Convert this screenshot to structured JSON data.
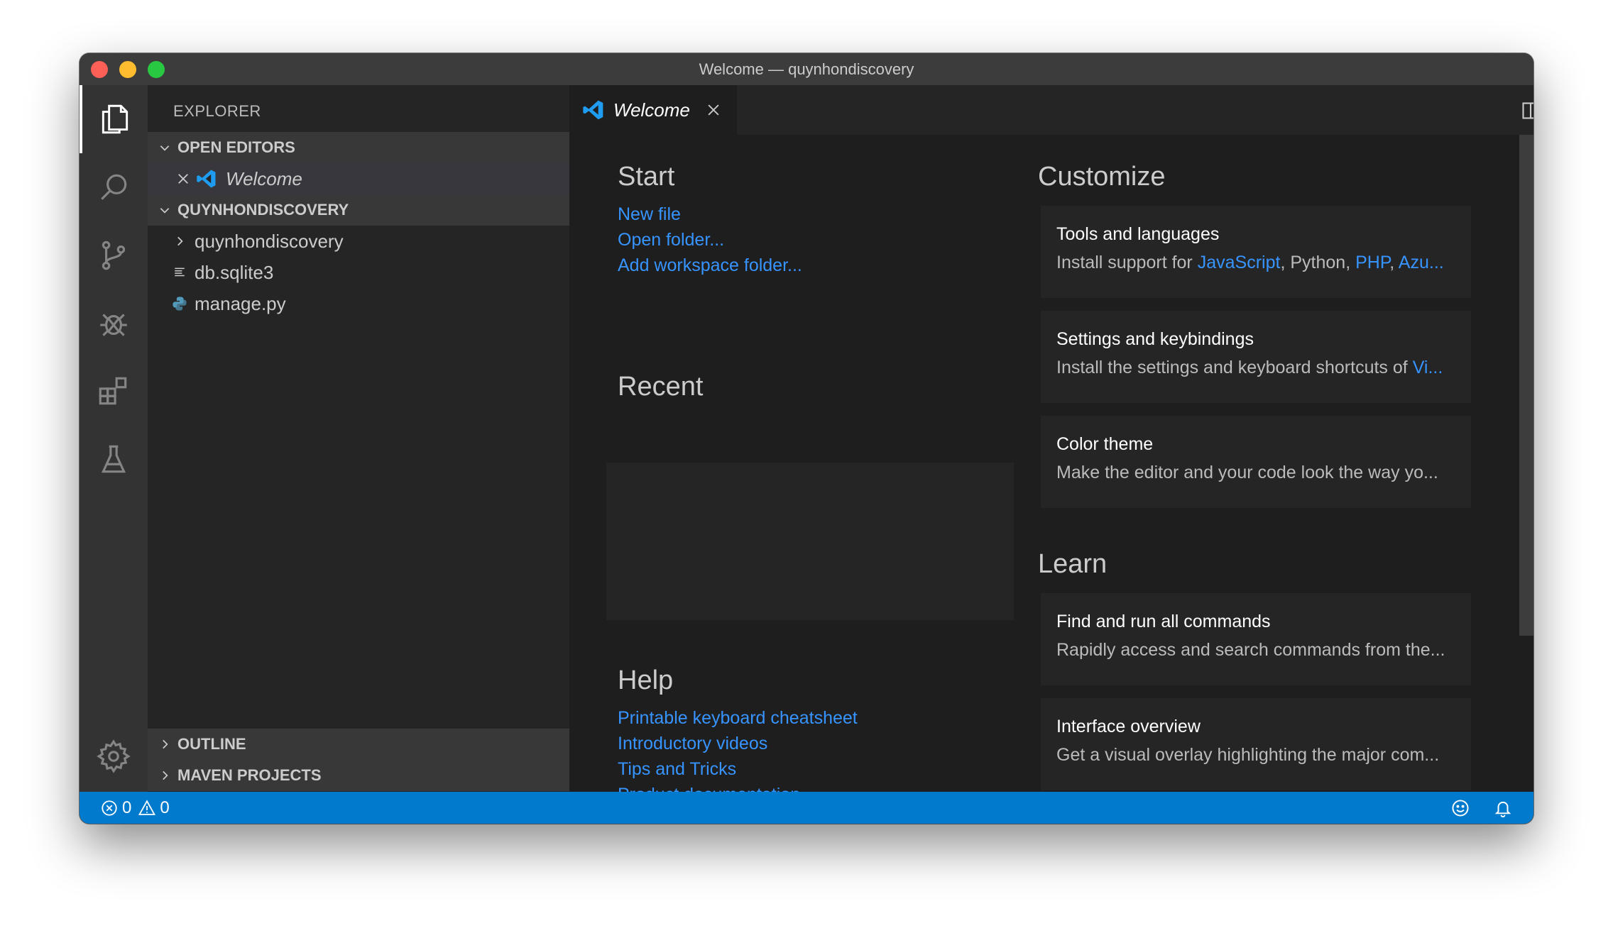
{
  "window": {
    "title": "Welcome — quynhondiscovery"
  },
  "sidebar": {
    "title": "EXPLORER",
    "open_editors": {
      "label": "OPEN EDITORS",
      "items": [
        {
          "label": "Welcome"
        }
      ]
    },
    "project": {
      "label": "QUYNHONDISCOVERY",
      "items": [
        {
          "label": "quynhondiscovery",
          "icon": "chevron-right-icon"
        },
        {
          "label": "db.sqlite3",
          "icon": "file-lines-icon"
        },
        {
          "label": "manage.py",
          "icon": "python-icon"
        }
      ]
    },
    "outline": {
      "label": "OUTLINE"
    },
    "maven": {
      "label": "MAVEN PROJECTS"
    }
  },
  "tabs": [
    {
      "label": "Welcome"
    }
  ],
  "welcome": {
    "start": {
      "heading": "Start",
      "links": [
        "New file",
        "Open folder...",
        "Add workspace folder..."
      ]
    },
    "recent": {
      "heading": "Recent"
    },
    "help": {
      "heading": "Help",
      "links": [
        "Printable keyboard cheatsheet",
        "Introductory videos",
        "Tips and Tricks",
        "Product documentation"
      ]
    },
    "customize": {
      "heading": "Customize",
      "cards": [
        {
          "title": "Tools and languages",
          "desc_prefix": "Install support for ",
          "desc_links": [
            "JavaScript",
            "Python",
            "PHP",
            "Azu..."
          ]
        },
        {
          "title": "Settings and keybindings",
          "desc_prefix": "Install the settings and keyboard shortcuts of ",
          "desc_link": "Vi..."
        },
        {
          "title": "Color theme",
          "desc": "Make the editor and your code look the way yo..."
        }
      ]
    },
    "learn": {
      "heading": "Learn",
      "cards": [
        {
          "title": "Find and run all commands",
          "desc": "Rapidly access and search commands from the..."
        },
        {
          "title": "Interface overview",
          "desc": "Get a visual overlay highlighting the major com..."
        }
      ]
    }
  },
  "status": {
    "errors": "0",
    "warnings": "0"
  },
  "colors": {
    "accent": "#007acc",
    "link": "#3794ff"
  }
}
